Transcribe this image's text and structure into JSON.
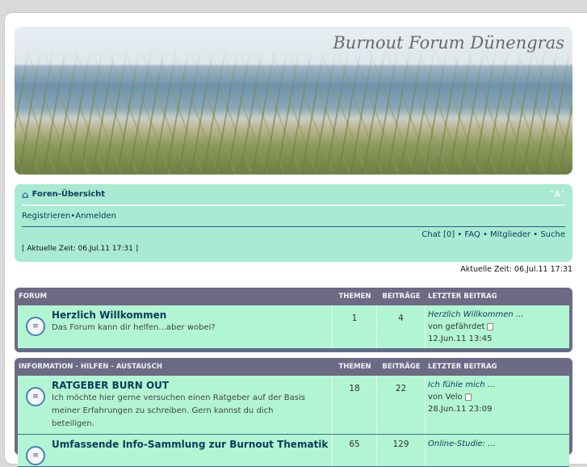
{
  "banner": {
    "title": "Burnout Forum Dünengras"
  },
  "nav": {
    "home": "Foren-Übersicht",
    "font_size": "˅A˄",
    "register": "Registrieren",
    "sep": " • ",
    "login": "Anmelden",
    "links": [
      "Chat [0]",
      "FAQ",
      "Mitglieder",
      "Suche"
    ],
    "time_box": "[ Aktuelle Zeit: 06.Jul.11 17:31 ]"
  },
  "time": "Aktuelle Zeit: 06.Jul.11 17:31",
  "headers": {
    "themen": "THEMEN",
    "beitraege": "BEITRÄGE",
    "letzter": "LETZTER BEITRAG"
  },
  "categories": [
    {
      "name": "FORUM",
      "forums": [
        {
          "title": "Herzlich Willkommen",
          "desc": "Das Forum kann dir helfen...aber wobei?",
          "topics": "1",
          "posts": "4",
          "last_title": "Herzlich Willkommen ...",
          "last_by": "von gefährdet",
          "last_date": "12.Jun.11 13:45"
        }
      ]
    },
    {
      "name": "INFORMATION - HILFEN - AUSTAUSCH",
      "forums": [
        {
          "title": "RATGEBER BURN OUT",
          "desc": "Ich möchte hier gerne versuchen einen Ratgeber auf der Basis meiner Erfahrungen zu schreiben. Gern kannst du dich beteiligen.",
          "topics": "18",
          "posts": "22",
          "last_title": "Ich fühle mich ...",
          "last_by": "von Velo",
          "last_date": "28.Jun.11 23:09"
        },
        {
          "title": "Umfassende Info-Sammlung zur Burnout Thematik",
          "topics": "65",
          "posts": "129",
          "last_title": "Online-Studie: ..."
        }
      ]
    }
  ]
}
